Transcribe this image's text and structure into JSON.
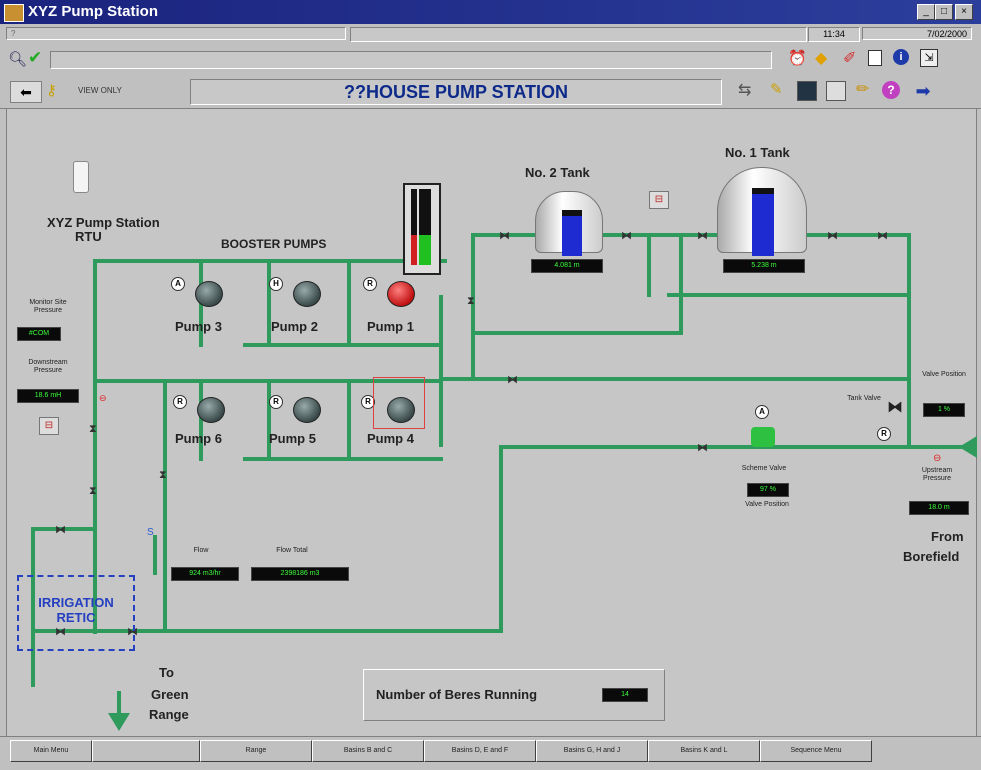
{
  "window": {
    "title": "XYZ Pump Station"
  },
  "status": {
    "time": "11:34",
    "date": "7/02/2000",
    "field_left": "?"
  },
  "toolbar": {
    "view_only": "VIEW ONLY",
    "page_title": "??HOUSE PUMP STATION"
  },
  "rtu": {
    "line1": "XYZ Pump Station",
    "line2": "RTU"
  },
  "booster": {
    "heading": "BOOSTER PUMPS"
  },
  "pumps": [
    {
      "label": "Pump 3",
      "mode": "A"
    },
    {
      "label": "Pump 2",
      "mode": "H"
    },
    {
      "label": "Pump 1",
      "mode": "R"
    },
    {
      "label": "Pump 6",
      "mode": "R"
    },
    {
      "label": "Pump 5",
      "mode": "R"
    },
    {
      "label": "Pump 4",
      "mode": "R"
    }
  ],
  "tanks": {
    "tank2": {
      "title": "No. 2 Tank",
      "level": "4.081 m"
    },
    "tank1": {
      "title": "No. 1 Tank",
      "level": "5.238 m"
    }
  },
  "left_panel": {
    "monitor_site_label": "Monitor Site Pressure",
    "monitor_site_value": "#COM",
    "downstream_label": "Downstream Pressure",
    "downstream_value": "18.6 mH"
  },
  "flow": {
    "flow_label": "Flow",
    "flow_value": "924 m3/hr",
    "total_label": "Flow Total",
    "total_value": "2398186 m3"
  },
  "irrigation": {
    "line1": "IRRIGATION",
    "line2": "RETIC"
  },
  "to_range": {
    "line1": "To",
    "line2": "Green",
    "line3": "Range"
  },
  "right_panel": {
    "valve_position_label": "Valve Position",
    "valve_position_value": "1 %",
    "tank_valve_label": "Tank Valve",
    "tank_valve_mode": "R",
    "scheme_valve_label": "Scheme Valve",
    "scheme_valve_value": "97 %",
    "scheme_valve_sub": "Valve Position",
    "scheme_valve_mode": "A",
    "upstream_label": "Upstream Pressure",
    "upstream_value": "18.0 m",
    "from_line1": "From",
    "from_line2": "Borefield"
  },
  "beres": {
    "label": "Number of Beres Running",
    "value": "14"
  },
  "bottom_menu": [
    "Main Menu",
    "",
    "Range",
    "Basins B and C",
    "Basins D, E and F",
    "Basins G, H and J",
    "Basins K and L",
    "Sequence Menu"
  ],
  "colors": {
    "pipe": "#2e9a5c",
    "title_bar": "#1a237e",
    "pump_running": "#e02020"
  }
}
